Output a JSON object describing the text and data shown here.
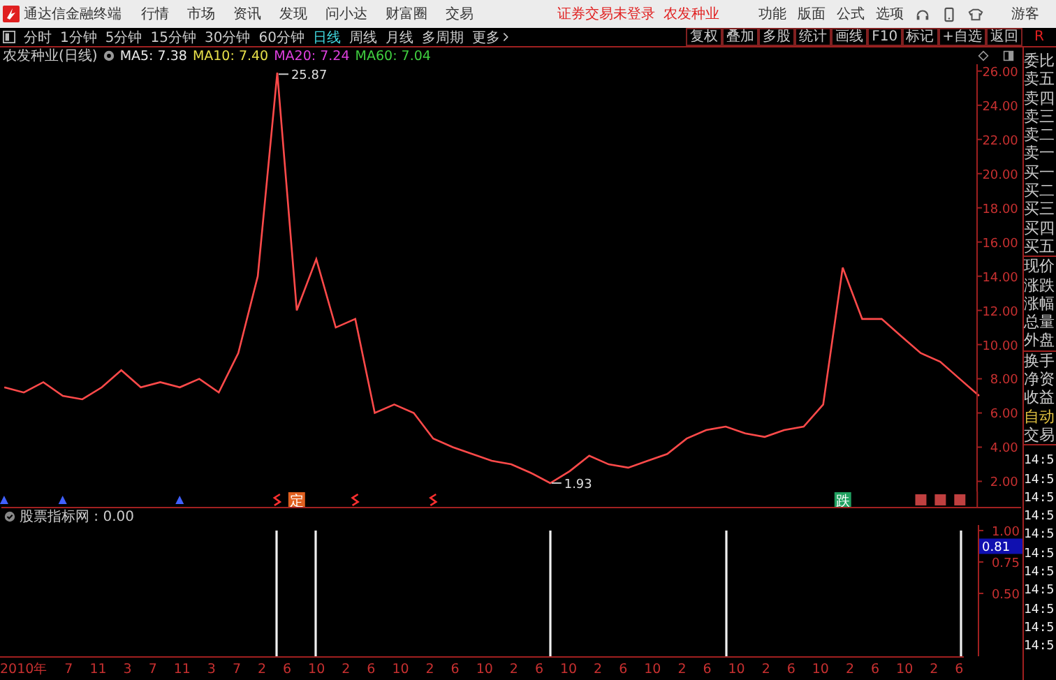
{
  "app_bar": {
    "title": "通达信金融终端",
    "menu": [
      "行情",
      "市场",
      "资讯",
      "发现",
      "问小达",
      "财富圈",
      "交易"
    ],
    "notice": "证券交易未登录",
    "stock": "农发种业",
    "tools": [
      "功能",
      "版面",
      "公式",
      "选项"
    ],
    "user": "游客"
  },
  "period_tabs": [
    {
      "label": "分时",
      "selected": false
    },
    {
      "label": "1分钟",
      "selected": false
    },
    {
      "label": "5分钟",
      "selected": false
    },
    {
      "label": "15分钟",
      "selected": false
    },
    {
      "label": "30分钟",
      "selected": false
    },
    {
      "label": "60分钟",
      "selected": false
    },
    {
      "label": "日线",
      "selected": true
    },
    {
      "label": "周线",
      "selected": false
    },
    {
      "label": "月线",
      "selected": false
    },
    {
      "label": "多周期",
      "selected": false
    },
    {
      "label": "更多",
      "selected": false
    }
  ],
  "chart_tools": [
    "复权",
    "叠加",
    "多股",
    "统计",
    "画线",
    "F10",
    "标记",
    "+自选",
    "返回"
  ],
  "right_flag": "R",
  "quote_header": {
    "title": "农发种业(日线)",
    "ma": [
      {
        "label": "MA5:",
        "value": "7.38",
        "color": "#e8e8e8"
      },
      {
        "label": "MA10:",
        "value": "7.40",
        "color": "#e8e04a"
      },
      {
        "label": "MA20:",
        "value": "7.24",
        "color": "#e040e0"
      },
      {
        "label": "MA60:",
        "value": "7.04",
        "color": "#40d040"
      }
    ]
  },
  "price_panel": {
    "chart_data": {
      "type": "line",
      "ylim": [
        1.4,
        26.4
      ],
      "yticks": [
        {
          "value": 2,
          "label": "2.00"
        },
        {
          "value": 4,
          "label": "4.00"
        },
        {
          "value": 6,
          "label": "6.00"
        },
        {
          "value": 8,
          "label": "8.00"
        },
        {
          "value": 10,
          "label": "10.00"
        },
        {
          "value": 12,
          "label": "12.00"
        },
        {
          "value": 14,
          "label": "14.00"
        },
        {
          "value": 16,
          "label": "16.00"
        },
        {
          "value": 18,
          "label": "18.00"
        },
        {
          "value": 20,
          "label": "20.00"
        },
        {
          "value": 22,
          "label": "22.00"
        },
        {
          "value": 24,
          "label": "24.00"
        },
        {
          "value": 26,
          "label": "26.00"
        }
      ],
      "series": [
        {
          "color": "#ff4a4a",
          "values": [
            7.5,
            7.2,
            7.8,
            7.0,
            6.8,
            7.5,
            8.5,
            7.5,
            7.8,
            7.5,
            8.0,
            7.2,
            9.5,
            14.0,
            25.9,
            12.0,
            15.0,
            11.0,
            11.5,
            6.0,
            6.5,
            6.0,
            4.5,
            4.0,
            3.6,
            3.2,
            3.0,
            2.5,
            1.9,
            2.6,
            3.5,
            3.0,
            2.8,
            3.2,
            3.6,
            4.5,
            5.0,
            5.2,
            4.8,
            4.6,
            5.0,
            5.2,
            6.5,
            14.5,
            11.5,
            11.5,
            10.5,
            9.5,
            9.0,
            8.0,
            7.0
          ]
        }
      ],
      "annotations": [
        {
          "text": "25.87"
        },
        {
          "text": "1.93"
        }
      ]
    },
    "signals": [
      {
        "kind": "buy"
      },
      {
        "kind": "buy"
      },
      {
        "kind": "buy"
      },
      {
        "kind": "sell"
      },
      {
        "kind": "tag",
        "text": "定",
        "color": "#e06020"
      },
      {
        "kind": "sell"
      },
      {
        "kind": "sell"
      },
      {
        "kind": "tag",
        "text": "跌",
        "color": "#20a060"
      },
      {
        "kind": "mark"
      },
      {
        "kind": "mark"
      },
      {
        "kind": "mark"
      }
    ]
  },
  "indicator": {
    "title": "股票指标网",
    "value": ": 0.00",
    "readout": "0.81",
    "chart_data": {
      "type": "bar",
      "ylim": [
        0,
        1.044
      ],
      "yticks": [
        {
          "value": 0.5,
          "label": "0.50"
        },
        {
          "value": 0.75,
          "label": "0.75"
        },
        {
          "value": 1,
          "label": "1.00"
        }
      ],
      "series": [
        {
          "color": "#f0f0f0",
          "values": [
            0,
            0,
            0,
            0,
            0,
            0,
            0,
            0,
            0,
            0,
            0,
            0,
            0,
            0,
            1,
            0,
            1,
            0,
            0,
            0,
            0,
            0,
            0,
            0,
            0,
            0,
            0,
            0,
            1,
            0,
            0,
            0,
            0,
            0,
            0,
            0,
            0,
            1,
            0,
            0,
            0,
            0,
            0,
            0,
            0,
            0,
            0,
            0,
            0,
            1,
            0
          ]
        }
      ]
    }
  },
  "date_axis": [
    "2010年",
    "7",
    "11",
    "3",
    "7",
    "11",
    "3",
    "7",
    "2",
    "6",
    "10",
    "2",
    "6",
    "10",
    "2",
    "6",
    "10",
    "2",
    "6",
    "10",
    "2",
    "6",
    "10",
    "2",
    "6",
    "10",
    "2",
    "6",
    "10",
    "2",
    "6",
    "10",
    "2",
    "6"
  ],
  "quote_panel": {
    "fields": [
      {
        "label": "委比",
        "kind": "label"
      },
      {
        "label": "卖五",
        "kind": "label"
      },
      {
        "label": "卖四",
        "kind": "label"
      },
      {
        "label": "卖三",
        "kind": "label"
      },
      {
        "label": "卖二",
        "kind": "label"
      },
      {
        "label": "卖一",
        "kind": "label"
      },
      {
        "label": "买一",
        "kind": "label"
      },
      {
        "label": "买二",
        "kind": "label"
      },
      {
        "label": "买三",
        "kind": "label"
      },
      {
        "label": "买四",
        "kind": "label"
      },
      {
        "label": "买五",
        "kind": "label"
      },
      {
        "label": "现价",
        "kind": "label"
      },
      {
        "label": "涨跌",
        "kind": "label"
      },
      {
        "label": "涨幅",
        "kind": "label"
      },
      {
        "label": "总量",
        "kind": "label"
      },
      {
        "label": "外盘",
        "kind": "label"
      },
      {
        "label": "换手",
        "kind": "label"
      },
      {
        "label": "净资",
        "kind": "label"
      },
      {
        "label": "收益",
        "kind": "label"
      },
      {
        "label": "自动",
        "kind": "toggle"
      },
      {
        "label": "交易",
        "kind": "label"
      }
    ],
    "tick_times": [
      "14:5",
      "14:5",
      "14:5",
      "14:5",
      "14:5",
      "14:5",
      "14:5",
      "14:5",
      "14:5",
      "14:5",
      "14:5"
    ]
  }
}
